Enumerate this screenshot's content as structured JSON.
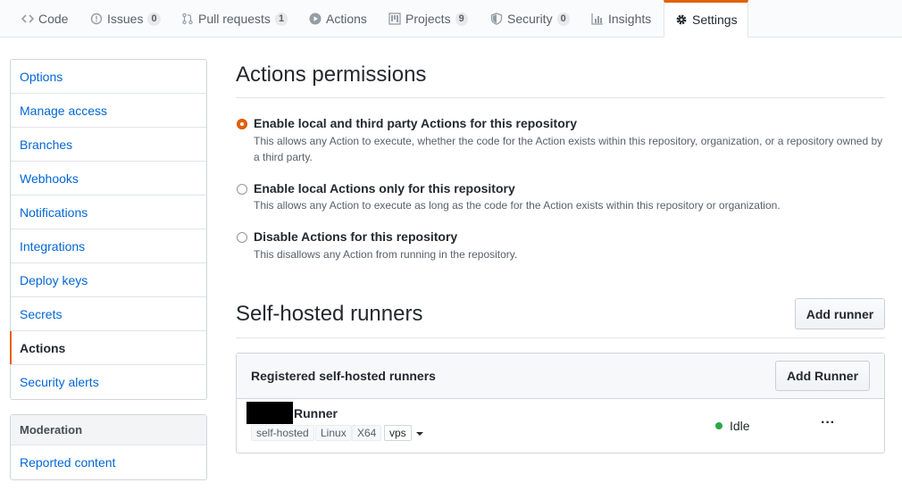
{
  "reponav": {
    "tabs": [
      {
        "label": "Code",
        "icon": "code-icon",
        "count": null
      },
      {
        "label": "Issues",
        "icon": "issue-icon",
        "count": "0"
      },
      {
        "label": "Pull requests",
        "icon": "pull-request-icon",
        "count": "1"
      },
      {
        "label": "Actions",
        "icon": "play-icon",
        "count": null
      },
      {
        "label": "Projects",
        "icon": "project-icon",
        "count": "9"
      },
      {
        "label": "Security",
        "icon": "shield-icon",
        "count": "0"
      },
      {
        "label": "Insights",
        "icon": "graph-icon",
        "count": null
      },
      {
        "label": "Settings",
        "icon": "gear-icon",
        "count": null
      }
    ],
    "selected": "Settings",
    "accent": "#e36209"
  },
  "sidebar": {
    "items": [
      {
        "label": "Options"
      },
      {
        "label": "Manage access"
      },
      {
        "label": "Branches"
      },
      {
        "label": "Webhooks"
      },
      {
        "label": "Notifications"
      },
      {
        "label": "Integrations"
      },
      {
        "label": "Deploy keys"
      },
      {
        "label": "Secrets"
      },
      {
        "label": "Actions"
      },
      {
        "label": "Security alerts"
      }
    ],
    "selected": "Actions",
    "moderation": {
      "heading": "Moderation",
      "items": [
        {
          "label": "Reported content"
        }
      ]
    }
  },
  "permissions": {
    "title": "Actions permissions",
    "options": [
      {
        "label": "Enable local and third party Actions for this repository",
        "note": "This allows any Action to execute, whether the code for the Action exists within this repository, organization, or a repository owned by a third party.",
        "checked": true
      },
      {
        "label": "Enable local Actions only for this repository",
        "note": "This allows any Action to execute as long as the code for the Action exists within this repository or organization.",
        "checked": false
      },
      {
        "label": "Disable Actions for this repository",
        "note": "This disallows any Action from running in the repository.",
        "checked": false
      }
    ]
  },
  "runners": {
    "title": "Self-hosted runners",
    "add_button": "Add runner",
    "box_title": "Registered self-hosted runners",
    "box_add_button": "Add Runner",
    "list": [
      {
        "name": "Runner",
        "labels": [
          "self-hosted",
          "Linux",
          "X64",
          "vps"
        ],
        "status": "Idle",
        "status_color": "#28a745"
      }
    ]
  }
}
